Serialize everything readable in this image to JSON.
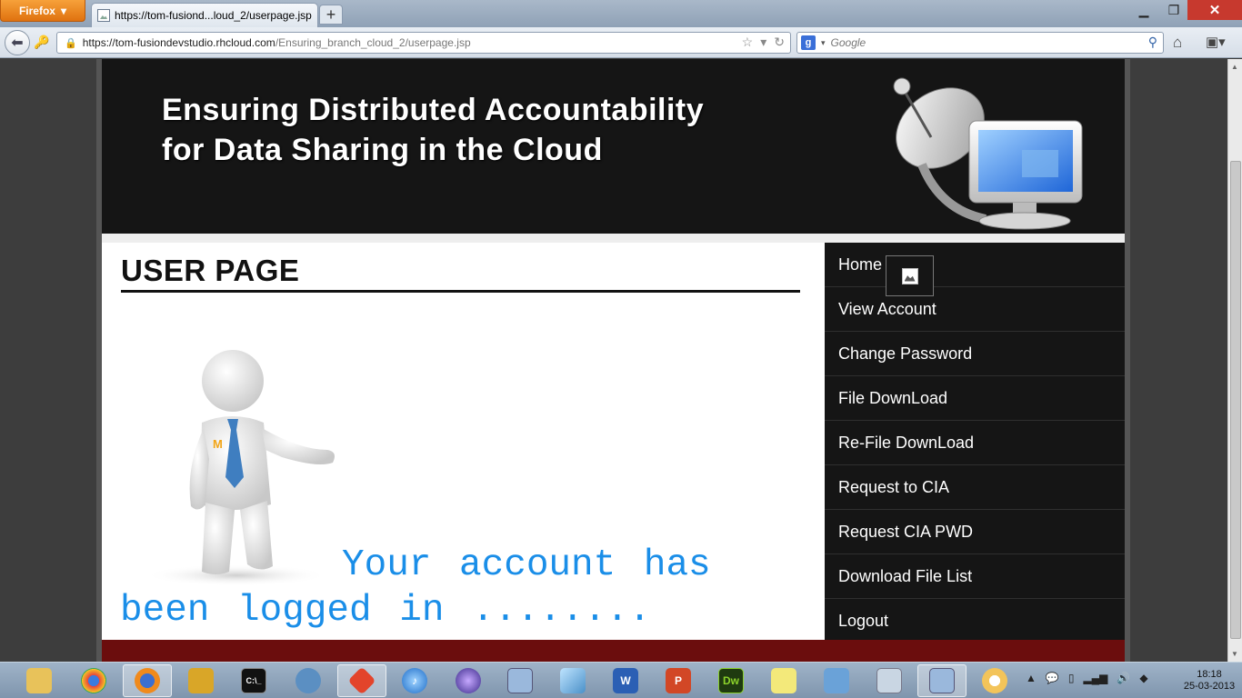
{
  "browser": {
    "app_button": "Firefox",
    "tab_title": "https://tom-fusiond...loud_2/userpage.jsp",
    "new_tab": "+",
    "url_host": "https://tom-fusiondevstudio.rhcloud.com",
    "url_path": "/Ensuring_branch_cloud_2/userpage.jsp",
    "search_placeholder": "Google"
  },
  "header": {
    "title_line1": "Ensuring Distributed Accountability",
    "title_line2": "for Data Sharing in the Cloud"
  },
  "main": {
    "page_title": "USER PAGE",
    "message": "Your account has been logged in ........",
    "badge_letter": "M"
  },
  "sidebar": {
    "items": [
      {
        "label": "Home"
      },
      {
        "label": "View Account"
      },
      {
        "label": "Change Password"
      },
      {
        "label": "File DownLoad"
      },
      {
        "label": "Re-File DownLoad"
      },
      {
        "label": "Request to CIA"
      },
      {
        "label": "Request CIA PWD"
      },
      {
        "label": "Download File List"
      },
      {
        "label": "Logout"
      }
    ]
  },
  "taskbar": {
    "time": "18:18",
    "date": "25-03-2013",
    "dw_label": "Dw",
    "word_label": "W"
  },
  "colors": {
    "header_bg": "#151515",
    "message": "#1a8ee8",
    "footer_red": "#6b0d0d",
    "firefox_orange": "#e0720f"
  }
}
